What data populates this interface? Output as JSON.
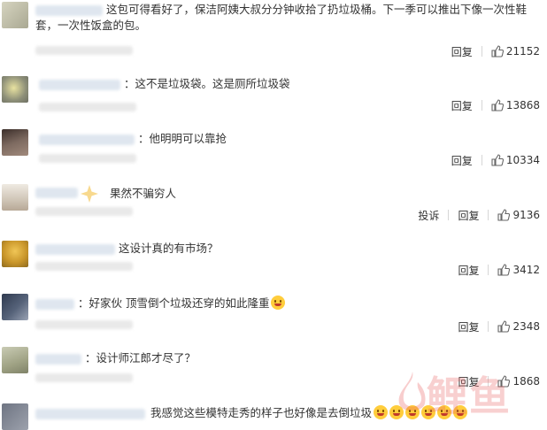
{
  "comments": [
    {
      "text": "这包可得看好了，保洁阿姨大叔分分钟收拾了扔垃圾桶。下一季可以推出下像一次性鞋套，一次性饭盒的包。",
      "reply": "回复",
      "likes": "21152",
      "avatar_color": "#c8c7b2"
    },
    {
      "text": "：这不是垃圾袋。这是厕所垃圾袋",
      "reply": "回复",
      "likes": "13868",
      "avatar_color": "#9a9a86"
    },
    {
      "text": "：他明明可以靠抢",
      "reply": "回复",
      "likes": "10334",
      "avatar_color": "#5e4f4a"
    },
    {
      "text": "果然不骗穷人",
      "report": "投诉",
      "reply": "回复",
      "likes": "9136",
      "avatar_color": "#d8d2c8"
    },
    {
      "text": "这设计真的有市场？",
      "reply": "回复",
      "likes": "3412",
      "avatar_color": "#c99a22"
    },
    {
      "text": "：好家伙 顶雪倒个垃圾还穿的如此隆重",
      "reply": "回复",
      "likes": "2348",
      "avatar_color": "#3d4a5e"
    },
    {
      "text": "：设计师江郎才尽了？",
      "reply": "回复",
      "likes": "1868",
      "avatar_color": "#b5b79c"
    },
    {
      "text": "我感觉这些模特走秀的样子也好像是去倒垃圾",
      "avatar_color": "#8b8f99"
    }
  ],
  "watermark": {
    "text": "鲤鱼"
  },
  "colors": {
    "like_icon": "#666666",
    "watermark": "#e95b5b"
  }
}
